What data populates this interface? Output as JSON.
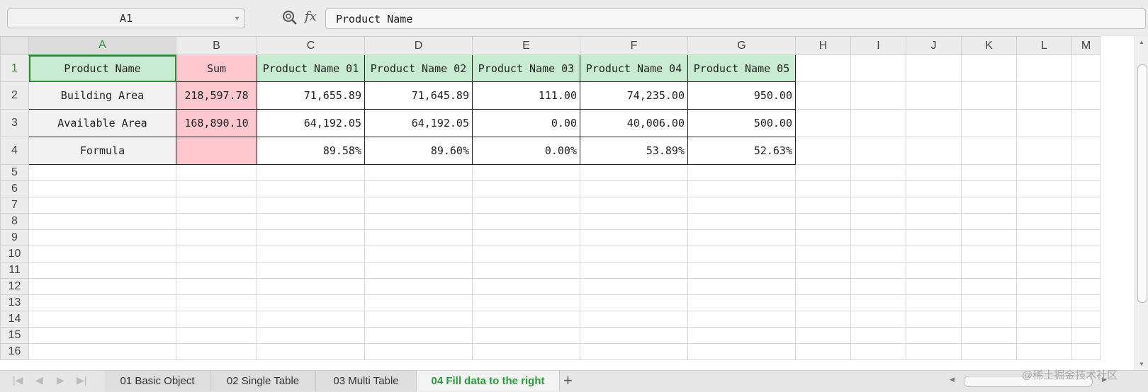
{
  "formula_bar": {
    "name_box": "A1",
    "fx_label": "fx",
    "formula": "Product Name"
  },
  "columns": [
    "A",
    "B",
    "C",
    "D",
    "E",
    "F",
    "G",
    "H",
    "I",
    "J",
    "K",
    "L",
    "M"
  ],
  "row_numbers": [
    "1",
    "2",
    "3",
    "4",
    "5",
    "6",
    "7",
    "8",
    "9",
    "10",
    "11",
    "12",
    "13",
    "14",
    "15",
    "16"
  ],
  "rows": [
    [
      "Product Name",
      "Sum",
      "Product Name 01",
      "Product Name 02",
      "Product Name 03",
      "Product Name 04",
      "Product Name 05"
    ],
    [
      "Building Area",
      "218,597.78",
      "71,655.89",
      "71,645.89",
      "111.00",
      "74,235.00",
      "950.00"
    ],
    [
      "Available Area",
      "168,890.10",
      "64,192.05",
      "64,192.05",
      "0.00",
      "40,006.00",
      "500.00"
    ],
    [
      "Formula",
      "",
      "89.58%",
      "89.60%",
      "0.00%",
      "53.89%",
      "52.63%"
    ]
  ],
  "sheet_tabs": [
    {
      "label": "01 Basic Object",
      "active": false
    },
    {
      "label": "02 Single Table",
      "active": false
    },
    {
      "label": "03 Multi Table",
      "active": false
    },
    {
      "label": "04 Fill data to the right",
      "active": true
    }
  ],
  "add_sheet": "+",
  "watermark": "@稀土掘金技术社区",
  "colors": {
    "header_green": "#c8eccf",
    "sum_pink": "#ffc7ce",
    "accent_green": "#2e9a3e"
  },
  "icons": [
    "zoom-icon",
    "dropdown-icon",
    "add-sheet-icon",
    "scroll-arrow-icon"
  ]
}
